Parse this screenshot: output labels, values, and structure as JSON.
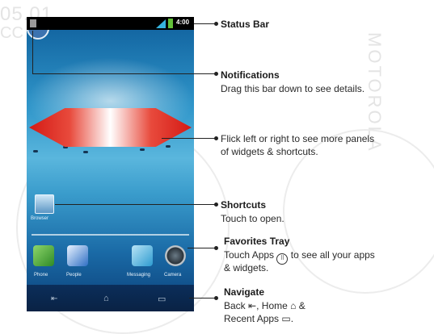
{
  "watermark": {
    "top_text": "05.01",
    "mid_text": "CC",
    "right_text": "MOTOROLA"
  },
  "statusbar": {
    "time": "4:00"
  },
  "shortcut": {
    "label": "Browser"
  },
  "tray": {
    "launcher_glyph": "⠿",
    "apps": [
      {
        "label": "Phone"
      },
      {
        "label": "People"
      },
      {
        "label": "Messaging"
      },
      {
        "label": "Camera"
      }
    ]
  },
  "navbar": {
    "back_glyph": "⇤",
    "home_glyph": "⌂",
    "recent_glyph": "▭"
  },
  "callouts": {
    "status": {
      "title": "Status Bar"
    },
    "notifications": {
      "title": "Notifications",
      "desc": "Drag this bar down to see details."
    },
    "flick": {
      "line1": "Flick left or right to see more panels",
      "line2": "of widgets & shortcuts."
    },
    "shortcuts": {
      "title": "Shortcuts",
      "desc": "Touch to open."
    },
    "favorites": {
      "title": "Favorites Tray",
      "desc_pre": "Touch Apps",
      "apps_glyph": "⠿",
      "desc_post": "to see all your apps",
      "line2": "& widgets."
    },
    "navigate": {
      "title": "Navigate",
      "back": "Back",
      "home": "Home",
      "amp": "&",
      "recent": "Recent Apps",
      "back_icon": "⇤",
      "home_icon": "⌂",
      "recent_icon": "▭",
      "period": "."
    }
  }
}
